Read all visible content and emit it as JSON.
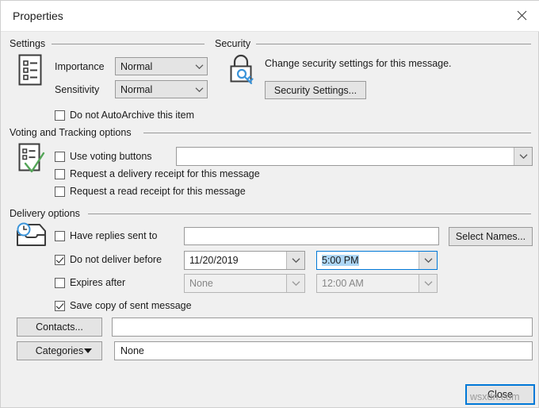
{
  "window": {
    "title": "Properties",
    "close_icon": "close-icon"
  },
  "settings": {
    "group_label": "Settings",
    "icon": "message-options-icon",
    "importance_label": "Importance",
    "importance_value": "Normal",
    "sensitivity_label": "Sensitivity",
    "sensitivity_value": "Normal",
    "autoarchive_label": "Do not AutoArchive this item",
    "autoarchive_checked": false
  },
  "security": {
    "group_label": "Security",
    "icon": "lock-key-icon",
    "description": "Change security settings for this message.",
    "settings_button": "Security Settings..."
  },
  "voting": {
    "group_label": "Voting and Tracking options",
    "icon": "voting-check-icon",
    "use_voting_label": "Use voting buttons",
    "use_voting_checked": false,
    "use_voting_value": "",
    "delivery_receipt_label": "Request a delivery receipt for this message",
    "delivery_receipt_checked": false,
    "read_receipt_label": "Request a read receipt for this message",
    "read_receipt_checked": false
  },
  "delivery": {
    "group_label": "Delivery options",
    "icon": "inbox-clock-icon",
    "replies_label": "Have replies sent to",
    "replies_checked": false,
    "replies_value": "",
    "select_names_button": "Select Names...",
    "not_before_label": "Do not deliver before",
    "not_before_checked": true,
    "not_before_date": "11/20/2019",
    "not_before_time": "5:00 PM",
    "expires_label": "Expires after",
    "expires_checked": false,
    "expires_date": "None",
    "expires_time": "12:00 AM",
    "save_copy_label": "Save copy of sent message",
    "save_copy_checked": true
  },
  "bottom": {
    "contacts_button": "Contacts...",
    "contacts_value": "",
    "categories_button_pre": "Cate",
    "categories_button_accel": "g",
    "categories_button_post": "ories",
    "categories_value": "None",
    "close_button": "Close"
  },
  "watermark": "wsxdn.com",
  "colors": {
    "accent": "#0078d7",
    "selection": "#add6f5",
    "dialog_bg": "#f0f0f0",
    "control_bg": "#e4e4e4",
    "border": "#9a9a9a",
    "icon_blue": "#3b94d9",
    "icon_green": "#53a557"
  }
}
